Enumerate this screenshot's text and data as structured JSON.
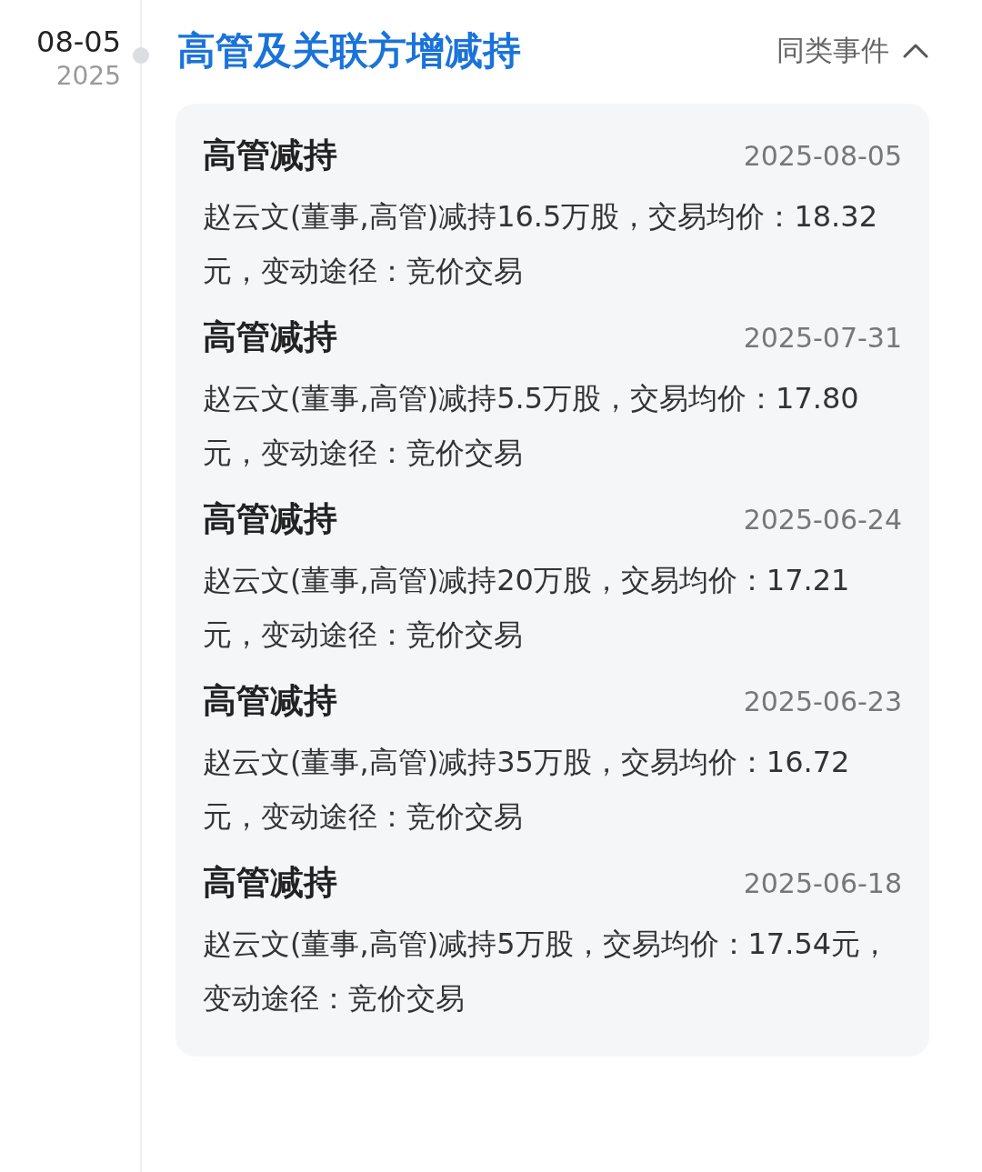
{
  "date": {
    "day": "08-05",
    "year": "2025"
  },
  "event": {
    "title": "高管及关联方增减持",
    "similar_label": "同类事件",
    "expanded": true,
    "items": [
      {
        "title": "高管减持",
        "date": "2025-08-05",
        "text": "赵云文(董事,高管)减持16.5万股，交易均价：18.32元，变动途径：竞价交易"
      },
      {
        "title": "高管减持",
        "date": "2025-07-31",
        "text": "赵云文(董事,高管)减持5.5万股，交易均价：17.80元，变动途径：竞价交易"
      },
      {
        "title": "高管减持",
        "date": "2025-06-24",
        "text": "赵云文(董事,高管)减持20万股，交易均价：17.21元，变动途径：竞价交易"
      },
      {
        "title": "高管减持",
        "date": "2025-06-23",
        "text": "赵云文(董事,高管)减持35万股，交易均价：16.72元，变动途径：竞价交易"
      },
      {
        "title": "高管减持",
        "date": "2025-06-18",
        "text": "赵云文(董事,高管)减持5万股，交易均价：17.54元，变动途径：竞价交易"
      }
    ]
  }
}
